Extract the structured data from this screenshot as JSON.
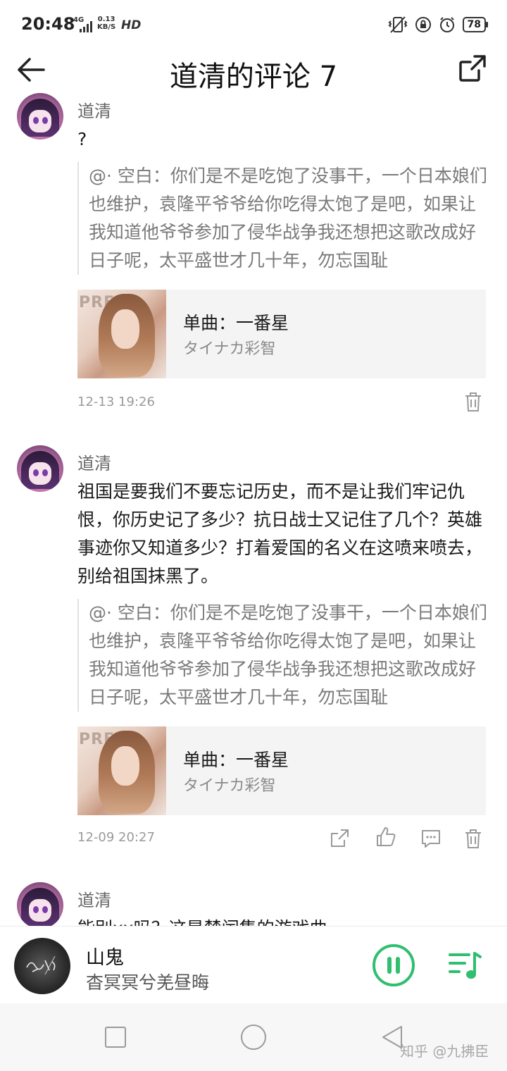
{
  "status_bar": {
    "time": "20:48",
    "network": "4G",
    "speed_value": "0.13",
    "speed_unit": "KB/S",
    "hd": "HD",
    "battery": "78"
  },
  "header": {
    "title": "道清的评论 7"
  },
  "comments": [
    {
      "username": "道清",
      "text": "?",
      "quote": "@· 空白：你们是不是吃饱了没事干，一个日本娘们也维护，袁隆平爷爷给你吃得太饱了是吧，如果让我知道他爷爷参加了侵华战争我还想把这歌改成好日子呢，太平盛世才几十年，勿忘国耻",
      "song_title": "单曲：一番星",
      "song_artist": "タイナカ彩智",
      "cover_text": "PRESS",
      "timestamp": "12-13 19:26"
    },
    {
      "username": "道清",
      "text": "祖国是要我们不要忘记历史，而不是让我们牢记仇恨，你历史记了多少？抗日战士又记住了几个？英雄事迹你又知道多少？打着爱国的名义在这喷来喷去，别给祖国抹黑了。",
      "quote": "@· 空白：你们是不是吃饱了没事干，一个日本娘们也维护，袁隆平爷爷给你吃得太饱了是吧，如果让我知道他爷爷参加了侵华战争我还想把这歌改成好日子呢，太平盛世才几十年，勿忘国耻",
      "song_title": "单曲：一番星",
      "song_artist": "タイナカ彩智",
      "cover_text": "PRESS",
      "timestamp": "12-09 20:27"
    },
    {
      "username": "道清",
      "text": "能别xx吗？这是楚闰集的游戏曲"
    }
  ],
  "player": {
    "song": "山鬼",
    "lyric": "杳冥冥兮羌昼晦"
  },
  "watermark": "知乎 @九拂臣",
  "colors": {
    "accent_green": "#2fbf6f",
    "text_gray": "#7a7a7a"
  }
}
